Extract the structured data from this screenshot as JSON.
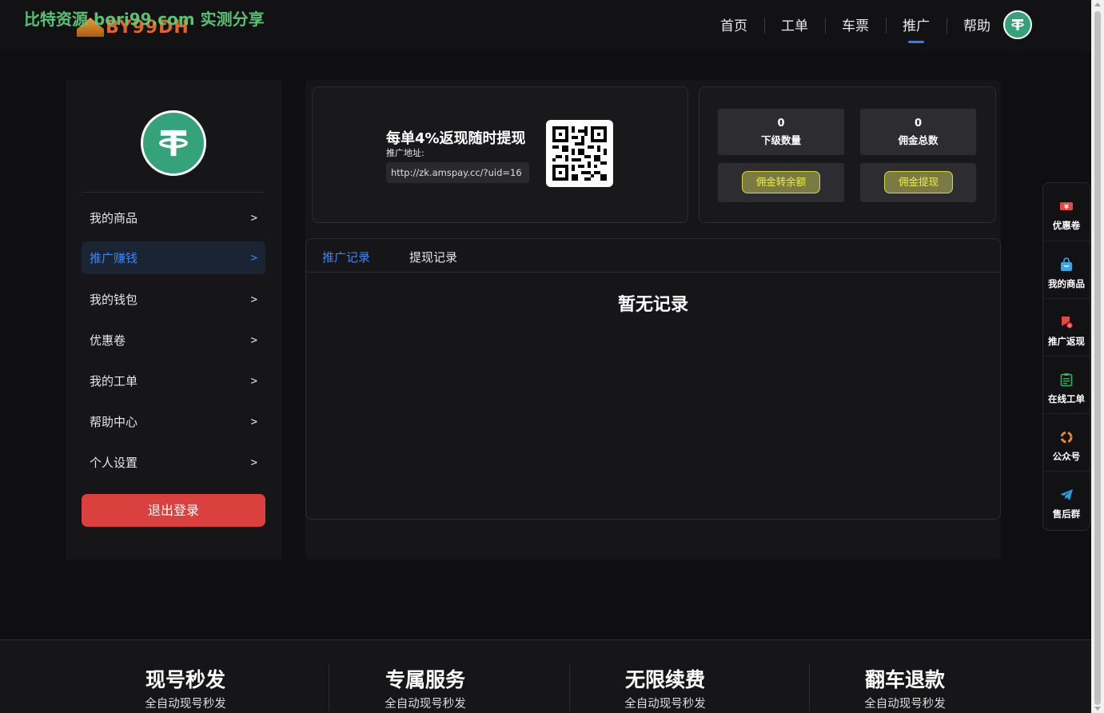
{
  "watermark": "比特资源 bori99.com 实测分享",
  "header": {
    "logo_text": "BY99DH",
    "nav": [
      "首页",
      "工单",
      "车票",
      "推广",
      "帮助"
    ],
    "active_nav": "推广"
  },
  "sidebar": {
    "items": [
      {
        "label": "我的商品",
        "arrow": ">"
      },
      {
        "label": "推广赚钱",
        "arrow": ">"
      },
      {
        "label": "我的钱包",
        "arrow": ">"
      },
      {
        "label": "优惠卷",
        "arrow": ">"
      },
      {
        "label": "我的工单",
        "arrow": ">"
      },
      {
        "label": "帮助中心",
        "arrow": ">"
      },
      {
        "label": "个人设置",
        "arrow": ">"
      }
    ],
    "active_item": "推广赚钱",
    "logout_label": "退出登录"
  },
  "promo": {
    "title": "每单4%返现随时提现",
    "address_label": "推广地址:",
    "url": "http://zk.amspay.cc/?uid=16"
  },
  "stats": {
    "subordinates": {
      "value": "0",
      "label": "下级数量"
    },
    "commission_total": {
      "value": "0",
      "label": "佣金总数"
    },
    "transfer_label": "佣金转余额",
    "withdraw_label": "佣金提现"
  },
  "records": {
    "tabs": [
      "推广记录",
      "提现记录"
    ],
    "active_tab": "推广记录",
    "empty_text": "暂无记录"
  },
  "floatbar": {
    "items": [
      {
        "label": "优惠卷",
        "icon": "coupon-icon",
        "color": "#e8473f"
      },
      {
        "label": "我的商品",
        "icon": "bag-icon",
        "color": "#3aa6e8"
      },
      {
        "label": "推广返现",
        "icon": "gift-icon",
        "color": "#e8473f"
      },
      {
        "label": "在线工单",
        "icon": "clipboard-icon",
        "color": "#2db35a"
      },
      {
        "label": "公众号",
        "icon": "wechat-icon",
        "color": "#e88a2b"
      },
      {
        "label": "售后群",
        "icon": "telegram-icon",
        "color": "#2a9fe0"
      }
    ]
  },
  "footer": {
    "features": [
      {
        "title": "现号秒发",
        "subtitle": "全自动现号秒发"
      },
      {
        "title": "专属服务",
        "subtitle": "全自动现号秒发"
      },
      {
        "title": "无限续费",
        "subtitle": "全自动现号秒发"
      },
      {
        "title": "翻车退款",
        "subtitle": "全自动现号秒发"
      }
    ]
  },
  "colors": {
    "accent": "#2f7ef2",
    "logout": "#d9403e",
    "tether": "#34a37b",
    "action_button_text": "#ecec4a"
  }
}
